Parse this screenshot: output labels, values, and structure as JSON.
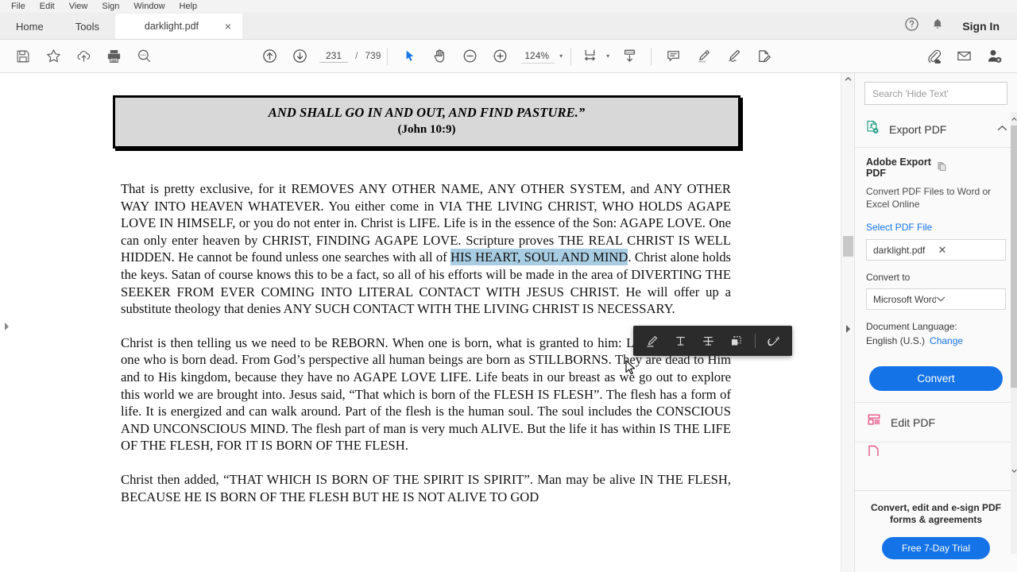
{
  "menubar": {
    "items": [
      {
        "label": "File"
      },
      {
        "label": "Edit"
      },
      {
        "label": "View"
      },
      {
        "label": "Sign"
      },
      {
        "label": "Window"
      },
      {
        "label": "Help"
      }
    ]
  },
  "tabstrip": {
    "home_label": "Home",
    "tools_label": "Tools",
    "document_tab": "darklight.pdf",
    "close_glyph": "×",
    "help_icon": "help-circle-icon",
    "bell_icon": "bell-icon",
    "sign_in_label": "Sign In"
  },
  "toolbar": {
    "save_icon": "save-icon",
    "star_icon": "star-icon",
    "cloud_upload_icon": "cloud-upload-icon",
    "print_icon": "print-icon",
    "search_icon": "search-icon",
    "prev_page_icon": "arrow-up-circle-icon",
    "next_page_icon": "arrow-down-circle-icon",
    "page_number": "231",
    "page_separator": "/",
    "page_total": "739",
    "select_tool_icon": "cursor-arrow-icon",
    "hand_tool_icon": "hand-icon",
    "zoom_out_icon": "minus-circle-icon",
    "zoom_in_icon": "plus-circle-icon",
    "zoom_level": "124%",
    "zoom_caret": "▾",
    "fit_page_icon": "fit-page-icon",
    "fit_caret": "▾",
    "scroll_mode_icon": "page-scroll-icon",
    "comment_icon": "comment-icon",
    "highlight_icon": "highlighter-icon",
    "draw_icon": "pen-draw-icon",
    "fill_sign_icon": "fill-and-sign-icon",
    "attach_icon": "attach-cloud-icon",
    "email_icon": "email-icon",
    "share_icon": "add-person-icon"
  },
  "floating_toolbar": {
    "highlight_icon": "highlight-marker-icon",
    "underline_icon": "underline-text-icon",
    "strikethrough_icon": "strikethrough-text-icon",
    "copy_icon": "copy-area-icon",
    "link_icon": "link-edit-icon"
  },
  "document": {
    "verse_line_1": "AND SHALL GO IN AND OUT, AND FIND PASTURE.”",
    "verse_line_2": "(John 10:9)",
    "paragraph_1_before": "That is pretty exclusive, for it REMOVES ANY OTHER NAME, ANY OTHER SYSTEM, and ANY OTHER WAY INTO HEAVEN WHATEVER. You either come in VIA THE LIVING CHRIST, WHO HOLDS AGAPE LOVE IN HIMSELF, or you do not enter in. Christ is LIFE. Life is in the essence of the Son: AGAPE LOVE. One can only enter heaven by CHRIST, FINDING AGAPE LOVE. Scripture proves THE REAL CHRIST IS WELL HIDDEN. He cannot be found unless one searches with all of ",
    "paragraph_1_selected": "HIS HEART, SOUL AND MIND",
    "paragraph_1_after": ". Christ alone holds the keys. Satan of course knows this to be a fact, so all of his efforts will be made in the area of DIVERTING THE SEEKER FROM EVER COMING INTO LITERAL CONTACT WITH JESUS CHRIST. He will offer up a substitute theology that denies ANY SUCH CONTACT WITH THE LIVING CHRIST IS NECESSARY.",
    "paragraph_2": "Christ is then telling us we need to be REBORN. When one is born, what is granted to him: LIFE. A stillborn is one who is born dead. From God’s perspective all human beings are born as STILLBORNS. They are dead to Him and to His kingdom, because they have no AGAPE LOVE LIFE. Life beats in our breast as we go out to explore this world we are brought into. Jesus said, “That which is born of the FLESH IS FLESH”. The flesh has a form of life. It is energized and can walk around. Part of the flesh is the human soul. The soul includes the CONSCIOUS AND UNCONSCIOUS MIND. The flesh part of man is very much ALIVE. But the life it has within IS THE LIFE OF THE FLESH, FOR IT IS BORN OF THE FLESH.",
    "paragraph_3": "Christ then added, “THAT WHICH IS BORN OF THE SPIRIT IS SPIRIT”. Man may be alive IN THE FLESH, BECAUSE HE IS BORN OF THE FLESH BUT HE IS NOT ALIVE TO GOD"
  },
  "sidebar": {
    "search_placeholder": "Search 'Hide Text'",
    "export_pdf": {
      "icon": "export-pdf-icon",
      "label": "Export PDF",
      "chevron": "⌃",
      "panel_title": "Adobe Export PDF",
      "copy_icon": "copy-pages-icon",
      "description": "Convert PDF Files to Word or Excel Online",
      "select_file_link": "Select PDF File",
      "file_name": "darklight.pdf",
      "file_clear_glyph": "✕",
      "convert_to_label": "Convert to",
      "convert_to_value": "Microsoft Word (*.docx)",
      "convert_caret": "⌄",
      "document_language_label": "Document Language:",
      "document_language_value": "English (U.S.)",
      "change_link": "Change",
      "convert_button": "Convert"
    },
    "edit_pdf": {
      "icon": "edit-pdf-icon",
      "label": "Edit PDF"
    },
    "promo": {
      "line1": "Convert, edit and e-sign PDF",
      "line2": "forms & agreements",
      "button": "Free 7-Day Trial"
    }
  },
  "colors": {
    "accent_blue": "#1473e6",
    "selection_blue": "#a8cde3",
    "export_green": "#1a9a7f",
    "edit_pink": "#e1407a"
  }
}
